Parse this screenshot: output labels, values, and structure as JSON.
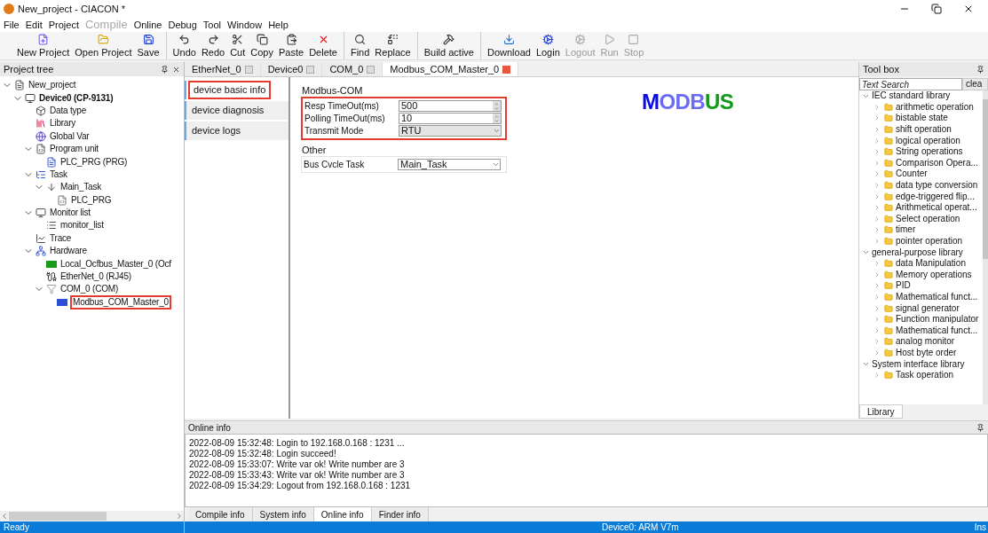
{
  "window": {
    "title": "New_project - CIACON *"
  },
  "menu": [
    {
      "label": "File",
      "disabled": false
    },
    {
      "label": "Edit",
      "disabled": false
    },
    {
      "label": "Project",
      "disabled": false
    },
    {
      "label": "Compile",
      "disabled": true
    },
    {
      "label": "Online",
      "disabled": false
    },
    {
      "label": "Debug",
      "disabled": false
    },
    {
      "label": "Tool",
      "disabled": false
    },
    {
      "label": "Window",
      "disabled": false
    },
    {
      "label": "Help",
      "disabled": false
    }
  ],
  "toolbar": [
    {
      "buttons": [
        {
          "label": "New Project",
          "disabled": false
        },
        {
          "label": "Open Project",
          "disabled": false
        },
        {
          "label": "Save",
          "disabled": false
        }
      ]
    },
    {
      "buttons": [
        {
          "label": "Undo",
          "disabled": false
        },
        {
          "label": "Redo",
          "disabled": false
        },
        {
          "label": "Cut",
          "disabled": false
        },
        {
          "label": "Copy",
          "disabled": false
        },
        {
          "label": "Paste",
          "disabled": false
        },
        {
          "label": "Delete",
          "disabled": false
        }
      ]
    },
    {
      "buttons": [
        {
          "label": "Find",
          "disabled": false
        },
        {
          "label": "Replace",
          "disabled": false
        }
      ]
    },
    {
      "buttons": [
        {
          "label": "Build active",
          "disabled": false
        }
      ]
    },
    {
      "buttons": [
        {
          "label": "Download",
          "disabled": false
        },
        {
          "label": "Login",
          "disabled": false
        },
        {
          "label": "Logout",
          "disabled": true
        },
        {
          "label": "Run",
          "disabled": true
        },
        {
          "label": "Stop",
          "disabled": true
        }
      ]
    }
  ],
  "project_tree": {
    "title": "Project tree",
    "items": [
      {
        "label": "New_project",
        "kind": "project",
        "expanded": true,
        "children": [
          {
            "label": "Device0 (CP-9131)",
            "kind": "device",
            "active": true,
            "expanded": true,
            "children": [
              {
                "label": "Data type",
                "kind": "datatype"
              },
              {
                "label": "Library",
                "kind": "library"
              },
              {
                "label": "Global Var",
                "kind": "globalvar"
              },
              {
                "label": "Program unit",
                "kind": "program",
                "expanded": true,
                "children": [
                  {
                    "label": "PLC_PRG (PRG)",
                    "kind": "pou"
                  }
                ]
              },
              {
                "label": "Task",
                "kind": "task",
                "expanded": true,
                "children": [
                  {
                    "label": "Main_Task",
                    "kind": "maintask",
                    "expanded": true,
                    "children": [
                      {
                        "label": "PLC_PRG",
                        "kind": "taskpou"
                      }
                    ]
                  }
                ]
              },
              {
                "label": "Monitor list",
                "kind": "monitor",
                "expanded": true,
                "children": [
                  {
                    "label": "monitor_list",
                    "kind": "list"
                  }
                ]
              },
              {
                "label": "Trace",
                "kind": "trace"
              },
              {
                "label": "Hardware",
                "kind": "hardware",
                "expanded": true,
                "children": [
                  {
                    "label": "Local_Ocfbus_Master_0 (Ocf",
                    "kind": "bus"
                  },
                  {
                    "label": "EtherNet_0 (RJ45)",
                    "kind": "ethernet"
                  },
                  {
                    "label": "COM_0 (COM)",
                    "kind": "com",
                    "expanded": true,
                    "children": [
                      {
                        "label": "Modbus_COM_Master_0",
                        "kind": "modbus",
                        "highlighted": true
                      }
                    ]
                  }
                ]
              }
            ]
          }
        ]
      }
    ]
  },
  "doc_tabs": [
    {
      "label": "EtherNet_0",
      "selected": false
    },
    {
      "label": "Device0",
      "selected": false
    },
    {
      "label": "COM_0",
      "selected": false
    },
    {
      "label": "Modbus_COM_Master_0",
      "selected": true
    }
  ],
  "device_nav": [
    {
      "label": "device basic info",
      "selected": true,
      "highlighted": true
    },
    {
      "label": "device diagnosis",
      "selected": false,
      "highlighted": false
    },
    {
      "label": "device logs",
      "selected": false,
      "highlighted": false
    }
  ],
  "groups": [
    {
      "title": "Modbus-COM",
      "highlighted": true,
      "fields": [
        {
          "label": "Resp TimeOut(ms)",
          "kind": "spin",
          "value": "500"
        },
        {
          "label": "Polling TimeOut(ms)",
          "kind": "spin",
          "value": "10"
        },
        {
          "label": "Transmit Mode",
          "kind": "select",
          "value": "RTU",
          "disabled": true
        }
      ]
    },
    {
      "title": "Other",
      "highlighted": false,
      "fields": [
        {
          "label": "Bus Cvcle Task",
          "kind": "select",
          "value": "Main_Task",
          "disabled": false
        }
      ]
    }
  ],
  "logo": [
    {
      "text": "M",
      "color": "#0a0ae8"
    },
    {
      "text": "ODB",
      "color": "#6b6bf5"
    },
    {
      "text": "US",
      "color": "#0f9a1a"
    }
  ],
  "toolbox": {
    "title": "Tool box",
    "search": {
      "placeholder": "Text Search"
    },
    "clear_button": "clea",
    "tab": "Library",
    "groups": [
      {
        "label": "IEC standard library",
        "expanded": true,
        "items": [
          "arithmetic operation",
          "bistable state",
          "shift operation",
          "logical operation",
          "String operations",
          "Comparison Opera...",
          "Counter",
          "data type conversion",
          "edge-triggered flip...",
          "Arithmetical operat...",
          "Select operation",
          "timer",
          "pointer operation"
        ]
      },
      {
        "label": "general-purpose library",
        "expanded": true,
        "items": [
          "data Manipulation",
          "Memory operations",
          "PID",
          "Mathematical funct...",
          "signal generator",
          "Function manipulator",
          "Mathematical funct...",
          "analog monitor",
          "Host byte order"
        ]
      },
      {
        "label": "System interface library",
        "expanded": true,
        "items": [
          "Task operation"
        ]
      }
    ]
  },
  "online_info": {
    "title": "Online info",
    "lines": [
      "2022-08-09 15:32:48: Login to 192.168.0.168 : 1231 ...",
      "2022-08-09 15:32:48: Login succeed!",
      "2022-08-09 15:33:07: Write var ok! Write number are 3",
      "2022-08-09 15:33:43: Write var ok! Write number are 3",
      "2022-08-09 15:34:29: Logout from 192.168.0.168 : 1231"
    ]
  },
  "bottom_tabs": [
    {
      "label": "Compile info",
      "selected": false
    },
    {
      "label": "System info",
      "selected": false
    },
    {
      "label": "Online info",
      "selected": true
    },
    {
      "label": "Finder info",
      "selected": false
    }
  ],
  "status_bar": {
    "left": "Ready",
    "center": "Device0: ARM V7m",
    "right": "Ins"
  }
}
